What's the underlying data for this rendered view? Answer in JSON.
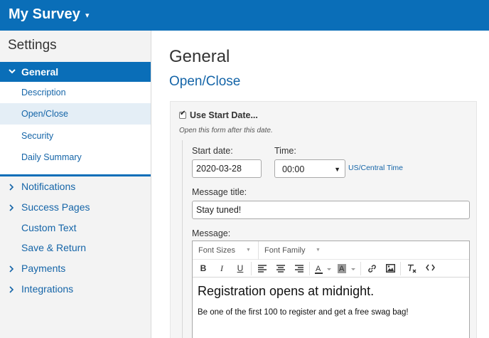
{
  "app": {
    "title": "My Survey",
    "title_caret": "▾"
  },
  "sidebar": {
    "title": "Settings",
    "general": {
      "label": "General",
      "expanded": true
    },
    "sub_items": [
      {
        "label": "Description",
        "active": false
      },
      {
        "label": "Open/Close",
        "active": true
      },
      {
        "label": "Security",
        "active": false
      },
      {
        "label": "Daily Summary",
        "active": false
      }
    ],
    "items": [
      {
        "label": "Notifications",
        "has_children": true
      },
      {
        "label": "Success Pages",
        "has_children": true
      },
      {
        "label": "Custom Text",
        "has_children": false
      },
      {
        "label": "Save & Return",
        "has_children": false
      },
      {
        "label": "Payments",
        "has_children": true
      },
      {
        "label": "Integrations",
        "has_children": true
      }
    ]
  },
  "main": {
    "heading": "General",
    "subheading": "Open/Close",
    "use_start_date": {
      "label": "Use Start Date...",
      "checked": true,
      "check_glyph": "✔"
    },
    "help_text": "Open this form after this date.",
    "start_date": {
      "label": "Start date:",
      "value": "2020-03-28"
    },
    "time": {
      "label": "Time:",
      "value": "00:00",
      "arrow": "▼"
    },
    "timezone": "US/Central Time",
    "message_title": {
      "label": "Message title:",
      "value": "Stay tuned!"
    },
    "message": {
      "label": "Message:",
      "toolbar": {
        "font_sizes": "Font Sizes",
        "font_family": "Font Family",
        "dd_arrow": "▼",
        "bold": "B",
        "italic": "I",
        "underline": "U"
      },
      "heading": "Registration opens at midnight.",
      "paragraph": "Be one of the first 100 to register and get a free swag bag!"
    }
  },
  "colors": {
    "brand": "#0a6eb8",
    "link": "#1565a8",
    "active_sub": "#e4eef6"
  }
}
